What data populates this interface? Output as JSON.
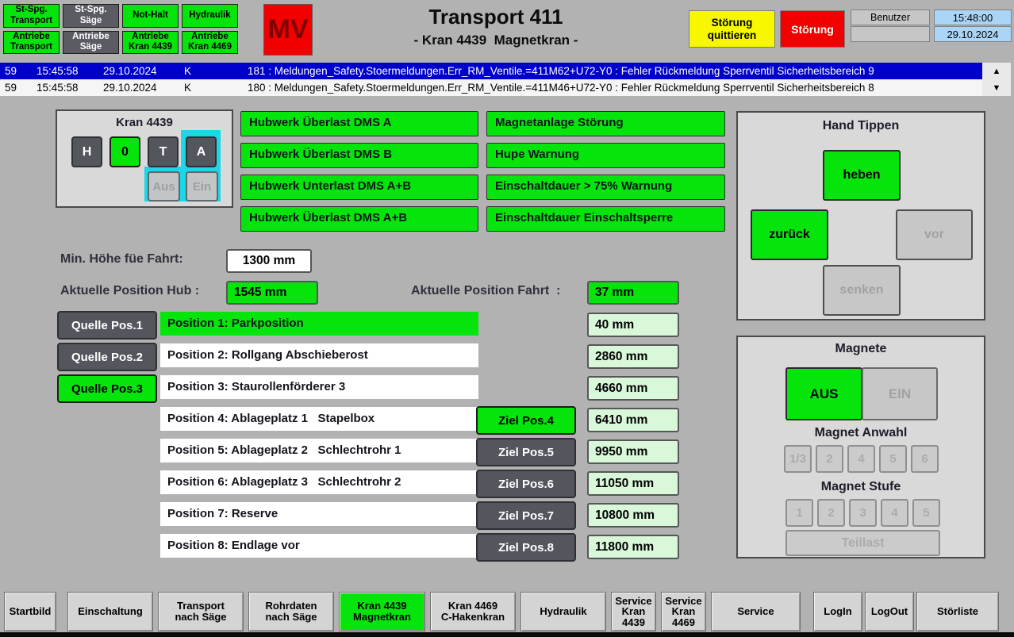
{
  "header": {
    "title": "Transport 411",
    "subtitle": "- Kran 4439  Magnetkran -",
    "top_buttons": [
      {
        "label": "St-Spg.\nTransport"
      },
      {
        "label": "St-Spg.\nSäge"
      },
      {
        "label": "Not-Halt"
      },
      {
        "label": "Hydraulik"
      },
      {
        "label": "Antriebe\nTransport"
      },
      {
        "label": "Antriebe\nSäge"
      },
      {
        "label": "Antriebe\nKran 4439"
      },
      {
        "label": "Antriebe\nKran 4469"
      }
    ],
    "mv_label": "MV",
    "ack_label": "Störung\nquittieren",
    "fault_label": "Störung",
    "user_label": "Benutzer",
    "user_value": "",
    "time": "15:48:00",
    "date": "29.10.2024"
  },
  "alarms": {
    "rows": [
      {
        "id": "59",
        "time": "15:45:58",
        "date": "29.10.2024",
        "k": "K",
        "message": "181 : Meldungen_Safety.Stoermeldungen.Err_RM_Ventile.=411M62+U72-Y0 : Fehler Rückmeldung Sperrventil Sicherheitsbereich 9"
      },
      {
        "id": "59",
        "time": "15:45:58",
        "date": "29.10.2024",
        "k": "K",
        "message": "180 : Meldungen_Safety.Stoermeldungen.Err_RM_Ventile.=411M46+U72-Y0 : Fehler Rückmeldung Sperrventil Sicherheitsbereich 8"
      }
    ],
    "scroll_up_icon": "▲",
    "scroll_down_icon": "▼"
  },
  "kran_panel": {
    "title": "Kran 4439",
    "btn_h": "H",
    "btn_0": "0",
    "btn_t": "T",
    "btn_a": "A",
    "btn_aus": "Aus",
    "btn_ein": "Ein"
  },
  "status_messages": {
    "left": [
      "Hubwerk Überlast DMS A",
      "Hubwerk Überlast DMS B",
      "Hubwerk Unterlast DMS A+B",
      "Hubwerk Überlast DMS A+B"
    ],
    "right": [
      "Magnetanlage Störung",
      "Hupe Warnung",
      "Einschaltdauer > 75% Warnung",
      "Einschaltdauer Einschaltsperre"
    ]
  },
  "measurements": {
    "min_hoehe_label": "Min. Höhe füe Fahrt:",
    "min_hoehe_value": "1300 mm",
    "pos_hub_label": "Aktuelle Position Hub :",
    "pos_hub_value": "1545 mm",
    "pos_fahrt_label": "Aktuelle Position Fahrt  :",
    "pos_fahrt_value": "37 mm"
  },
  "positions": {
    "rows": [
      {
        "quelle": "Quelle Pos.1",
        "label": "Position 1: Parkposition",
        "value": "40 mm"
      },
      {
        "quelle": "Quelle Pos.2",
        "label": "Position 2: Rollgang Abschieberost",
        "value": "2860 mm"
      },
      {
        "quelle": "Quelle Pos.3",
        "label": "Position 3: Staurollenförderer 3",
        "value": "4660 mm"
      },
      {
        "ziel": "Ziel Pos.4",
        "label": "Position 4: Ablageplatz 1   Stapelbox",
        "value": "6410 mm"
      },
      {
        "ziel": "Ziel Pos.5",
        "label": "Position 5: Ablageplatz 2   Schlechtrohr 1",
        "value": "9950 mm"
      },
      {
        "ziel": "Ziel Pos.6",
        "label": "Position 6: Ablageplatz 3   Schlechtrohr 2",
        "value": "11050 mm"
      },
      {
        "ziel": "Ziel Pos.7",
        "label": "Position 7: Reserve",
        "value": "10800 mm"
      },
      {
        "ziel": "Ziel Pos.8",
        "label": "Position 8: Endlage vor",
        "value": "11800 mm"
      }
    ]
  },
  "hand_tippen": {
    "title": "Hand Tippen",
    "heben": "heben",
    "zurueck": "zurück",
    "vor": "vor",
    "senken": "senken"
  },
  "magnete": {
    "title": "Magnete",
    "aus": "AUS",
    "ein": "EIN",
    "anwahl_label": "Magnet Anwahl",
    "anwahl_buttons": [
      "1/3",
      "2",
      "4",
      "5",
      "6"
    ],
    "stufe_label": "Magnet Stufe",
    "stufe_buttons": [
      "1",
      "2",
      "3",
      "4",
      "5"
    ],
    "teillast": "Teillast"
  },
  "bottom_nav": {
    "items": [
      {
        "label": "Startbild"
      },
      {
        "label": "Einschaltung"
      },
      {
        "label": "Transport\nnach Säge"
      },
      {
        "label": "Rohrdaten\nnach Säge"
      },
      {
        "label": "Kran 4439\nMagnetkran"
      },
      {
        "label": "Kran 4469\nC-Hakenkran"
      },
      {
        "label": "Hydraulik"
      },
      {
        "label": "Service\nKran\n4439"
      },
      {
        "label": "Service\nKran\n4469"
      },
      {
        "label": "Service"
      },
      {
        "label": "LogIn"
      },
      {
        "label": "LogOut"
      },
      {
        "label": "Störliste"
      }
    ]
  },
  "colors": {
    "green": "#05e50c",
    "yellow": "#f7f700",
    "red": "#f20000",
    "alarm_blue": "#0000cc",
    "cyan_highlight": "#1bd7e8",
    "light_green_field": "#d9f7d9",
    "light_blue_field": "#abd5f6"
  }
}
